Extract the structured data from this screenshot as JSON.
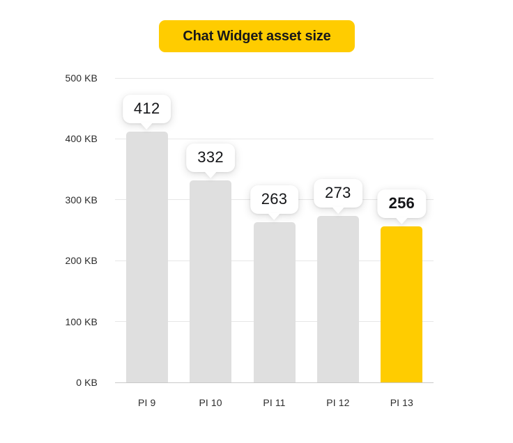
{
  "title": {
    "text": "Chat Widget asset size",
    "badge_color": "#FFCC00",
    "text_color": "#17181A"
  },
  "colors": {
    "bar_default": "#DFDFDF",
    "bar_highlight": "#FFCC00",
    "gridline": "#E7E7E7",
    "axis_line": "#C9C9C9",
    "tooltip_background": "#FFFFFF",
    "label_text": "#2B2B2B"
  },
  "chart_data": {
    "type": "bar",
    "title": "Chat Widget asset size",
    "xlabel": "",
    "ylabel": "",
    "unit": "KB",
    "categories": [
      "PI 9",
      "PI 10",
      "PI 11",
      "PI 12",
      "PI 13"
    ],
    "values": [
      412,
      332,
      263,
      273,
      256
    ],
    "data_labels": [
      "412",
      "332",
      "263",
      "273",
      "256"
    ],
    "highlight_index": 4,
    "highlight_label_bold": true,
    "ylim": [
      0,
      500
    ],
    "ytick_values": [
      500,
      400,
      300,
      200,
      100,
      0
    ],
    "ytick_labels": [
      "500 KB",
      "400 KB",
      "300 KB",
      "200 KB",
      "100 KB",
      "0 KB"
    ],
    "grid": true,
    "grid_axis": "y",
    "legend": false,
    "legend_position": "none",
    "series": [
      {
        "name": "Chat Widget asset size",
        "values": [
          412,
          332,
          263,
          273,
          256
        ]
      }
    ]
  },
  "y_axis": {
    "ticks": [
      {
        "label": "500 KB",
        "value": 500
      },
      {
        "label": "400 KB",
        "value": 400
      },
      {
        "label": "300 KB",
        "value": 300
      },
      {
        "label": "200 KB",
        "value": 200
      },
      {
        "label": "100 KB",
        "value": 100
      },
      {
        "label": "0 KB",
        "value": 0
      }
    ]
  },
  "x_axis": {
    "ticks": [
      {
        "label": "PI 9"
      },
      {
        "label": "PI 10"
      },
      {
        "label": "PI 11"
      },
      {
        "label": "PI 12"
      },
      {
        "label": "PI 13"
      }
    ]
  },
  "bars": [
    {
      "category": "PI 9",
      "value": 412,
      "label": "412",
      "highlight": false,
      "bold_label": false
    },
    {
      "category": "PI 10",
      "value": 332,
      "label": "332",
      "highlight": false,
      "bold_label": false
    },
    {
      "category": "PI 11",
      "value": 263,
      "label": "263",
      "highlight": false,
      "bold_label": false
    },
    {
      "category": "PI 12",
      "value": 273,
      "label": "273",
      "highlight": false,
      "bold_label": false
    },
    {
      "category": "PI 13",
      "value": 256,
      "label": "256",
      "highlight": true,
      "bold_label": true
    }
  ]
}
